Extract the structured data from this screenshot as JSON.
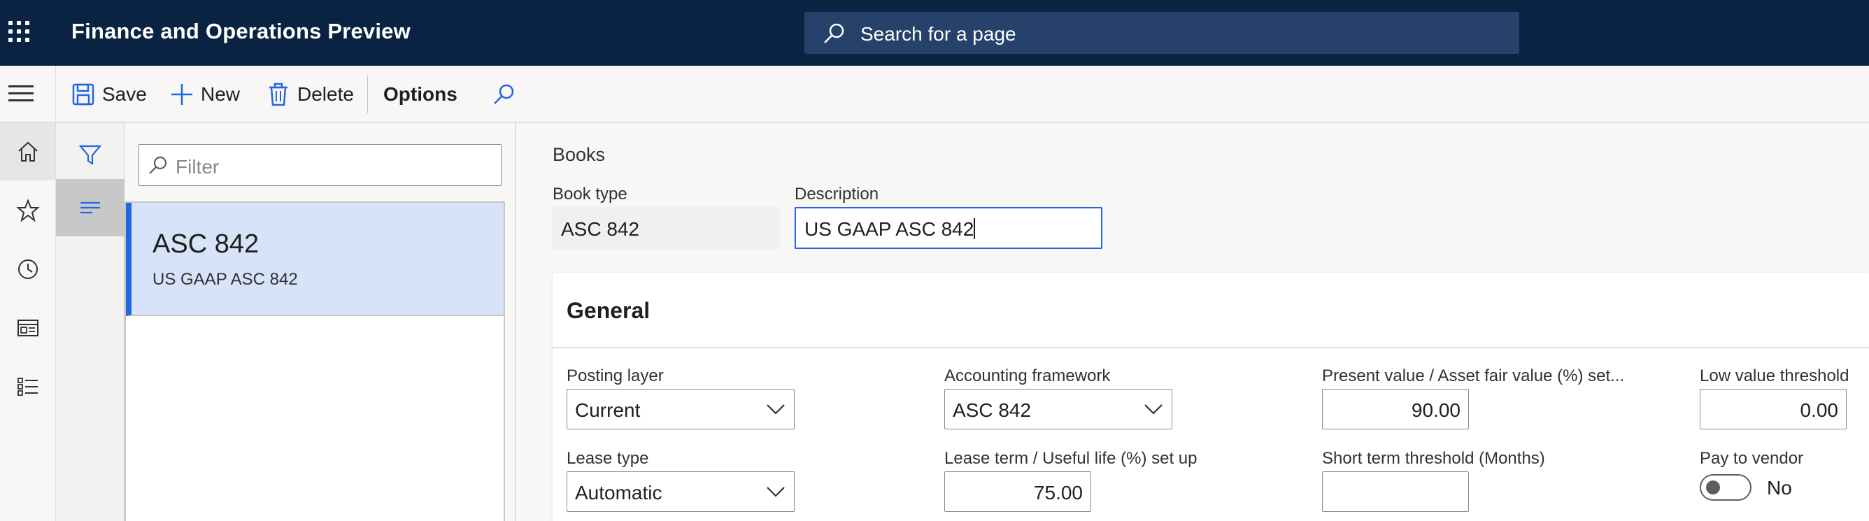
{
  "app": {
    "title": "Finance and Operations Preview",
    "search_placeholder": "Search for a page"
  },
  "actions": {
    "save": "Save",
    "new": "New",
    "delete": "Delete",
    "options": "Options"
  },
  "nav_rail": [
    "hamburger-icon",
    "home-icon",
    "star-icon",
    "clock-icon",
    "workspace-icon",
    "list-icon"
  ],
  "list": {
    "filter_placeholder": "Filter",
    "items": [
      {
        "title": "ASC 842",
        "subtitle": "US GAAP ASC 842",
        "selected": true
      }
    ]
  },
  "details": {
    "section": "Books",
    "book_type_label": "Book type",
    "book_type_value": "ASC 842",
    "description_label": "Description",
    "description_value": "US GAAP ASC 842",
    "general": {
      "header": "General",
      "posting_layer_label": "Posting layer",
      "posting_layer_value": "Current",
      "accounting_framework_label": "Accounting framework",
      "accounting_framework_value": "ASC 842",
      "present_value_label": "Present value / Asset fair value (%) set...",
      "present_value_value": "90.00",
      "low_value_label": "Low value threshold",
      "low_value_value": "0.00",
      "lease_type_label": "Lease type",
      "lease_type_value": "Automatic",
      "lease_term_label": "Lease term / Useful life (%) set up",
      "lease_term_value": "75.00",
      "short_term_label": "Short term threshold (Months)",
      "short_term_value": "",
      "pay_to_vendor_label": "Pay to vendor",
      "pay_to_vendor_value": "No"
    }
  },
  "colors": {
    "topbar": "#0b2343",
    "search": "#26416a",
    "accent": "#2266e3",
    "selected_row": "#d6e3f8"
  }
}
